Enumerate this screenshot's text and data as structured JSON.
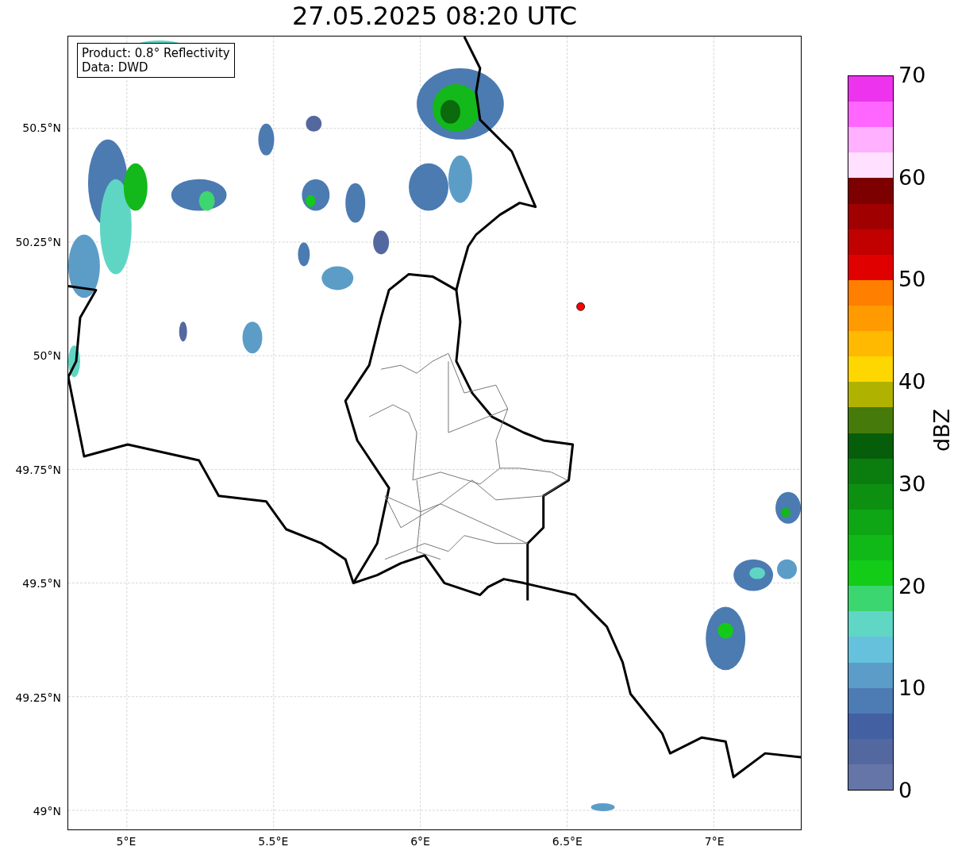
{
  "title": "27.05.2025 08:20 UTC",
  "annotation": [
    "Product: 0.8° Reflectivity",
    "Data: DWD"
  ],
  "map": {
    "lat_ticks": [
      "50.5°N",
      "50.25°N",
      "50°N",
      "49.75°N",
      "49.5°N",
      "49.25°N",
      "49°N"
    ],
    "lon_ticks": [
      "5°E",
      "5.5°E",
      "6°E",
      "6.5°E",
      "7°E"
    ]
  },
  "colorbar": {
    "label": "dBZ",
    "ticks": [
      "70",
      "60",
      "50",
      "40",
      "30",
      "20",
      "10",
      "0"
    ],
    "bands": [
      {
        "color": "#ee33ee"
      },
      {
        "color": "#ff66ff"
      },
      {
        "color": "#ffb0ff"
      },
      {
        "color": "#ffe0ff"
      },
      {
        "color": "#7d0000"
      },
      {
        "color": "#a10000"
      },
      {
        "color": "#c10000"
      },
      {
        "color": "#e10000"
      },
      {
        "color": "#ff7f00"
      },
      {
        "color": "#ff9a00"
      },
      {
        "color": "#ffb900"
      },
      {
        "color": "#ffd700"
      },
      {
        "color": "#b0b200"
      },
      {
        "color": "#467a0a"
      },
      {
        "color": "#075e0a"
      },
      {
        "color": "#0b7d0f"
      },
      {
        "color": "#0d9012"
      },
      {
        "color": "#0ea614"
      },
      {
        "color": "#10b818"
      },
      {
        "color": "#12cc18"
      },
      {
        "color": "#3cd670"
      },
      {
        "color": "#60d6c4"
      },
      {
        "color": "#66c2dc"
      },
      {
        "color": "#5b9dc8"
      },
      {
        "color": "#4d7bb3"
      },
      {
        "color": "#4360a3"
      },
      {
        "color": "#5468a0"
      },
      {
        "color": "#6575a8"
      }
    ]
  }
}
